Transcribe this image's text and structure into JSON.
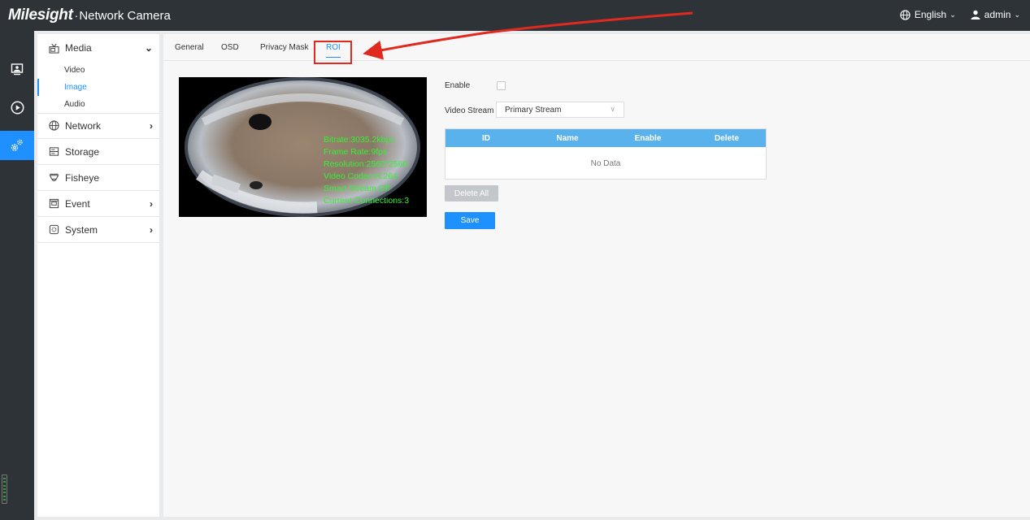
{
  "brand": {
    "logo": "Milesight",
    "separator": "·",
    "product": "Network Camera"
  },
  "topbar": {
    "language": "English",
    "user": "admin"
  },
  "rail": {
    "items": [
      {
        "icon": "live-view-icon",
        "active": false
      },
      {
        "icon": "playback-icon",
        "active": false
      },
      {
        "icon": "settings-icon",
        "active": true
      }
    ]
  },
  "menu": {
    "groups": [
      {
        "label": "Media",
        "icon": "media-icon",
        "expanded": true
      },
      {
        "label": "Network",
        "icon": "globe-icon",
        "expanded": false
      },
      {
        "label": "Storage",
        "icon": "storage-icon",
        "expanded": false
      },
      {
        "label": "Fisheye",
        "icon": "fisheye-icon",
        "expanded": false
      },
      {
        "label": "Event",
        "icon": "event-icon",
        "expanded": false
      },
      {
        "label": "System",
        "icon": "system-icon",
        "expanded": false
      }
    ],
    "media_sub": [
      {
        "label": "Video",
        "active": false
      },
      {
        "label": "Image",
        "active": true
      },
      {
        "label": "Audio",
        "active": false
      }
    ]
  },
  "tabs": [
    {
      "label": "General",
      "active": false
    },
    {
      "label": "OSD",
      "active": false
    },
    {
      "label": "Privacy Mask",
      "active": false
    },
    {
      "label": "ROI",
      "active": true
    }
  ],
  "video": {
    "osd": [
      "Bitrate:3035.2kbps",
      "Frame Rate:9fps",
      "Resolution:2560*2560",
      "Video Codec:H.264",
      "Smart Stream:Off",
      "Current Connections:3"
    ]
  },
  "form": {
    "enable_label": "Enable",
    "enable_checked": false,
    "stream_label": "Video Stream",
    "stream_value": "Primary Stream"
  },
  "table": {
    "headers": [
      "ID",
      "Name",
      "Enable",
      "Delete"
    ],
    "empty_text": "No Data"
  },
  "buttons": {
    "delete_all": "Delete All",
    "save": "Save"
  },
  "colors": {
    "accent": "#1e90ff",
    "topbar": "#2e3338",
    "table_header": "#5ab2ec",
    "annotation": "#e0291f"
  }
}
